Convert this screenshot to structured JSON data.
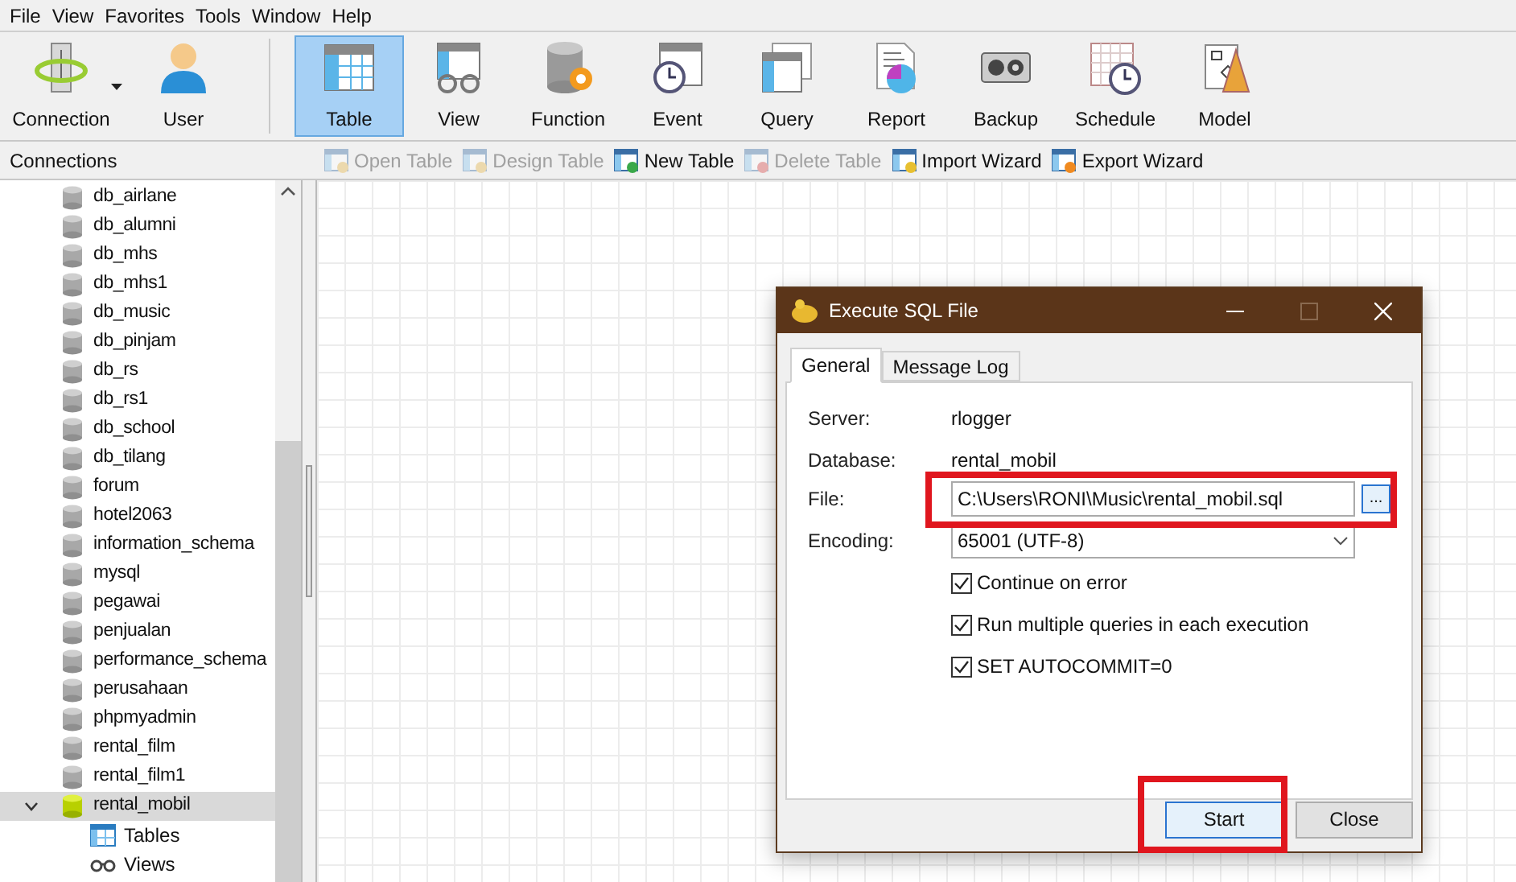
{
  "menu": [
    "File",
    "View",
    "Favorites",
    "Tools",
    "Window",
    "Help"
  ],
  "toolbar": {
    "left": [
      {
        "label": "Connection",
        "kind": "connection",
        "dropdown": true
      },
      {
        "label": "User",
        "kind": "user",
        "dropdown": false
      }
    ],
    "main": [
      {
        "label": "Table",
        "kind": "table",
        "selected": true
      },
      {
        "label": "View",
        "kind": "view",
        "selected": false
      },
      {
        "label": "Function",
        "kind": "function",
        "selected": false
      },
      {
        "label": "Event",
        "kind": "event",
        "selected": false
      },
      {
        "label": "Query",
        "kind": "query",
        "selected": false
      },
      {
        "label": "Report",
        "kind": "report",
        "selected": false
      },
      {
        "label": "Backup",
        "kind": "backup",
        "selected": false
      },
      {
        "label": "Schedule",
        "kind": "schedule",
        "selected": false
      },
      {
        "label": "Model",
        "kind": "model",
        "selected": false
      }
    ]
  },
  "sidebar": {
    "title": "Connections",
    "items": [
      {
        "label": "db_airlane",
        "selected": false,
        "expanded": false
      },
      {
        "label": "db_alumni",
        "selected": false,
        "expanded": false
      },
      {
        "label": "db_mhs",
        "selected": false,
        "expanded": false
      },
      {
        "label": "db_mhs1",
        "selected": false,
        "expanded": false
      },
      {
        "label": "db_music",
        "selected": false,
        "expanded": false
      },
      {
        "label": "db_pinjam",
        "selected": false,
        "expanded": false
      },
      {
        "label": "db_rs",
        "selected": false,
        "expanded": false
      },
      {
        "label": "db_rs1",
        "selected": false,
        "expanded": false
      },
      {
        "label": "db_school",
        "selected": false,
        "expanded": false
      },
      {
        "label": "db_tilang",
        "selected": false,
        "expanded": false
      },
      {
        "label": "forum",
        "selected": false,
        "expanded": false
      },
      {
        "label": "hotel2063",
        "selected": false,
        "expanded": false
      },
      {
        "label": "information_schema",
        "selected": false,
        "expanded": false
      },
      {
        "label": "mysql",
        "selected": false,
        "expanded": false
      },
      {
        "label": "pegawai",
        "selected": false,
        "expanded": false
      },
      {
        "label": "penjualan",
        "selected": false,
        "expanded": false
      },
      {
        "label": "performance_schema",
        "selected": false,
        "expanded": false
      },
      {
        "label": "perusahaan",
        "selected": false,
        "expanded": false
      },
      {
        "label": "phpmyadmin",
        "selected": false,
        "expanded": false
      },
      {
        "label": "rental_film",
        "selected": false,
        "expanded": false
      },
      {
        "label": "rental_film1",
        "selected": false,
        "expanded": false
      },
      {
        "label": "rental_mobil",
        "selected": true,
        "expanded": true,
        "children": [
          {
            "label": "Tables",
            "kind": "tables"
          },
          {
            "label": "Views",
            "kind": "views"
          }
        ]
      }
    ]
  },
  "actions": [
    {
      "label": "Open Table",
      "kind": "open",
      "disabled": true
    },
    {
      "label": "Design Table",
      "kind": "design",
      "disabled": true
    },
    {
      "label": "New Table",
      "kind": "new",
      "disabled": false
    },
    {
      "label": "Delete Table",
      "kind": "delete",
      "disabled": true
    },
    {
      "label": "Import Wizard",
      "kind": "import",
      "disabled": false
    },
    {
      "label": "Export Wizard",
      "kind": "export",
      "disabled": false
    }
  ],
  "dialog": {
    "title": "Execute SQL File",
    "tabs": [
      {
        "label": "General",
        "selected": true
      },
      {
        "label": "Message Log",
        "selected": false
      }
    ],
    "server_label": "Server:",
    "server": "rlogger",
    "database_label": "Database:",
    "database": "rental_mobil",
    "file_label": "File:",
    "file": {
      "value": "C:\\Users\\RONI\\Music\\rental_mobil.sql",
      "browse": "...",
      "highlighted": true
    },
    "encoding_label": "Encoding:",
    "encoding": "65001 (UTF-8)",
    "options": [
      {
        "label": "Continue on error",
        "checked": true
      },
      {
        "label": "Run multiple queries in each execution",
        "checked": true
      },
      {
        "label": "SET AUTOCOMMIT=0",
        "checked": true
      }
    ],
    "buttons": [
      {
        "label": "Start",
        "kind": "primary",
        "highlighted": true
      },
      {
        "label": "Close",
        "kind": "secondary",
        "highlighted": false
      }
    ]
  }
}
